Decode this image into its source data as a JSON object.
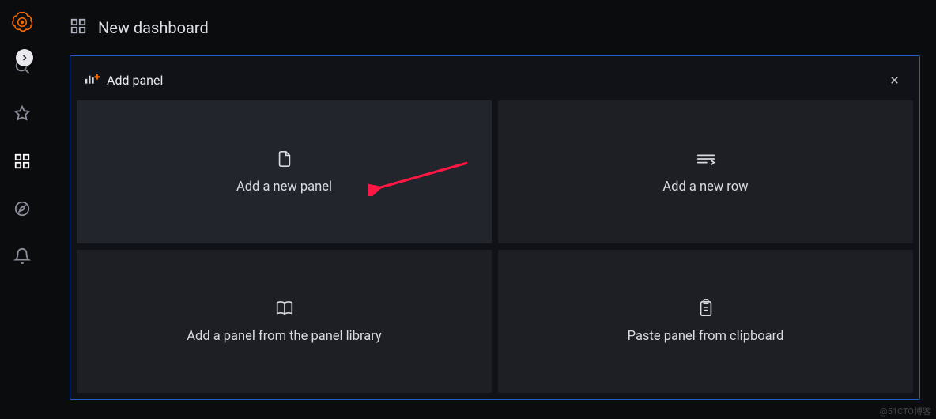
{
  "header": {
    "title": "New dashboard"
  },
  "panel": {
    "title": "Add panel"
  },
  "cards": {
    "new_panel": "Add a new panel",
    "new_row": "Add a new row",
    "panel_library": "Add a panel from the panel library",
    "paste_clipboard": "Paste panel from clipboard"
  },
  "watermark": "@51CTO博客"
}
